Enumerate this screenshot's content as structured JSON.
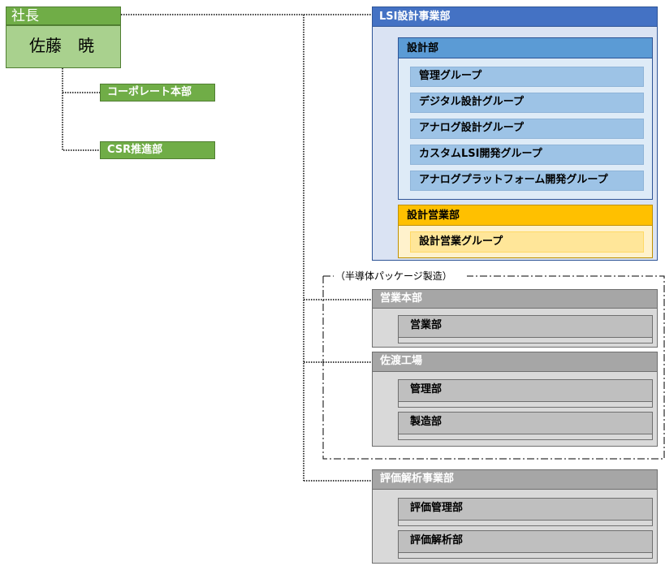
{
  "president": {
    "title": "社長",
    "name": "佐藤　暁"
  },
  "staff": {
    "corporate": "コーポレート本部",
    "csr": "CSR推進部"
  },
  "lsi": {
    "title": "LSI設計事業部",
    "design_dept": {
      "title": "設計部",
      "groups": [
        "管理グループ",
        "デジタル設計グループ",
        "アナログ設計グループ",
        "カスタムLSI開発グループ",
        "アナログプラットフォーム開発グループ"
      ]
    },
    "sales_design_dept": {
      "title": "設計営業部",
      "groups": [
        "設計営業グループ"
      ]
    }
  },
  "packaging": {
    "label": "（半導体パッケージ製造）",
    "sales_hq": {
      "title": "営業本部",
      "depts": [
        "営業部"
      ]
    },
    "sado_factory": {
      "title": "佐渡工場",
      "depts": [
        "管理部",
        "製造部"
      ]
    }
  },
  "evaluation": {
    "title": "評価解析事業部",
    "depts": [
      "評価管理部",
      "評価解析部"
    ]
  },
  "colors": {
    "green": "#70ad47",
    "blue_dark": "#4472c4",
    "blue_mid": "#5b9bd5",
    "blue_light": "#9dc3e6",
    "orange": "#ffc000",
    "orange_light": "#ffe699",
    "gray_head": "#a6a6a6",
    "gray_panel": "#d9d9d9"
  }
}
